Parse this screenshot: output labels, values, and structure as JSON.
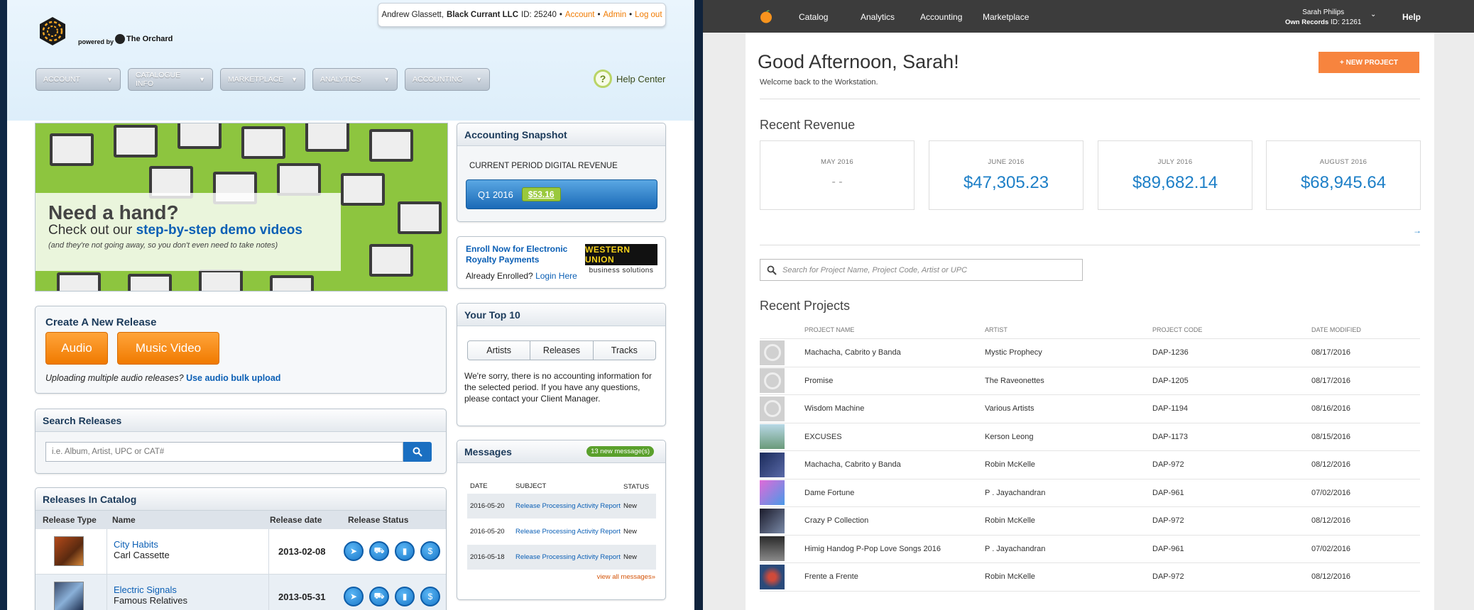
{
  "old_ui": {
    "userbar": {
      "user": "Andrew Glassett,",
      "company": "Black Currant LLC",
      "id": "ID: 25240",
      "sep": "•",
      "links": [
        "Account",
        "Admin",
        "Log out"
      ]
    },
    "powered_by": "powered by",
    "brand": "The Orchard",
    "nav": [
      "ACCOUNT",
      "CATALOGUE INFO",
      "MARKETPLACE",
      "ANALYTICS",
      "ACCOUNTING"
    ],
    "help_center": "Help Center",
    "banner": {
      "heading": "Need a hand?",
      "line_prefix": "Check out our",
      "line_link": "step-by-step demo videos",
      "subtext": "(and they're not going away, so you don't even need to take notes)"
    },
    "create": {
      "title": "Create A New Release",
      "audio": "Audio",
      "music_video": "Music Video",
      "note": "Uploading multiple audio releases?",
      "note_link": "Use audio bulk upload"
    },
    "search": {
      "title": "Search Releases",
      "placeholder": "i.e. Album, Artist, UPC or CAT#"
    },
    "catalog": {
      "title": "Releases In Catalog",
      "columns": [
        "Release Type",
        "Name",
        "Release date",
        "Release Status"
      ],
      "rows": [
        {
          "title": "City Habits",
          "artist": "Carl Cassette",
          "date": "2013-02-08"
        },
        {
          "title": "Electric Signals",
          "artist": "Famous Relatives",
          "date": "2013-05-31"
        }
      ]
    },
    "snapshot": {
      "title": "Accounting Snapshot",
      "label": "CURRENT PERIOD DIGITAL REVENUE",
      "period": "Q1 2016",
      "amount": "$53.16"
    },
    "enroll": {
      "link": "Enroll Now for Electronic Royalty Payments",
      "already": "Already Enrolled?",
      "login": "Login Here",
      "wu_logo": "WESTERN UNION",
      "wu_sub": "business solutions"
    },
    "top10": {
      "title": "Your Top 10",
      "tabs": [
        "Artists",
        "Releases",
        "Tracks"
      ],
      "message": "We're sorry, there is no accounting information for the selected period. If you have any questions, please contact your Client Manager."
    },
    "messages": {
      "title": "Messages",
      "badge": "13 new message(s)",
      "columns": [
        "DATE",
        "SUBJECT",
        "STATUS"
      ],
      "rows": [
        {
          "date": "2016-05-20",
          "subject": "Release Processing Activity Report",
          "status": "New"
        },
        {
          "date": "2016-05-20",
          "subject": "Release Processing Activity Report",
          "status": "New"
        },
        {
          "date": "2016-05-18",
          "subject": "Release Processing Activity Report",
          "status": "New"
        }
      ],
      "view_all": "view all messages»"
    }
  },
  "new_ui": {
    "nav": [
      "Catalog",
      "Analytics",
      "Accounting",
      "Marketplace"
    ],
    "account_name": "Sarah Philips",
    "account_org": "Own Records",
    "account_id": "ID: 21261",
    "help": "Help",
    "greeting": "Good Afternoon, Sarah!",
    "welcome": "Welcome back to the Workstation.",
    "new_project": "+ NEW PROJECT",
    "revenue_title": "Recent Revenue",
    "revenue": [
      {
        "month": "MAY 2016",
        "value": "- -"
      },
      {
        "month": "JUNE 2016",
        "value": "$47,305.23"
      },
      {
        "month": "JULY 2016",
        "value": "$89,682.14"
      },
      {
        "month": "AUGUST 2016",
        "value": "$68,945.64"
      }
    ],
    "arrow": "→",
    "search_placeholder": "Search for Project Name, Project Code, Artist or UPC",
    "projects_title": "Recent Projects",
    "columns": [
      "PROJECT NAME",
      "ARTIST",
      "PROJECT CODE",
      "DATE MODIFIED"
    ],
    "projects": [
      {
        "name": "Machacha, Cabrito y Banda",
        "artist": "Mystic Prophecy",
        "code": "DAP-1236",
        "date": "08/17/2016"
      },
      {
        "name": "Promise",
        "artist": "The Raveonettes",
        "code": "DAP-1205",
        "date": "08/17/2016"
      },
      {
        "name": "Wisdom Machine",
        "artist": "Various Artists",
        "code": "DAP-1194",
        "date": "08/16/2016"
      },
      {
        "name": "EXCUSES",
        "artist": "Kerson Leong",
        "code": "DAP-1173",
        "date": "08/15/2016"
      },
      {
        "name": "Machacha, Cabrito y Banda",
        "artist": "Robin McKelle",
        "code": "DAP-972",
        "date": "08/12/2016"
      },
      {
        "name": "Dame Fortune",
        "artist": "P . Jayachandran",
        "code": "DAP-961",
        "date": "07/02/2016"
      },
      {
        "name": "Crazy P Collection",
        "artist": "Robin McKelle",
        "code": "DAP-972",
        "date": "08/12/2016"
      },
      {
        "name": "Himig Handog P-Pop Love Songs 2016",
        "artist": "P . Jayachandran",
        "code": "DAP-961",
        "date": "07/02/2016"
      },
      {
        "name": "Frente a Frente",
        "artist": "Robin McKelle",
        "code": "DAP-972",
        "date": "08/12/2016"
      }
    ]
  }
}
